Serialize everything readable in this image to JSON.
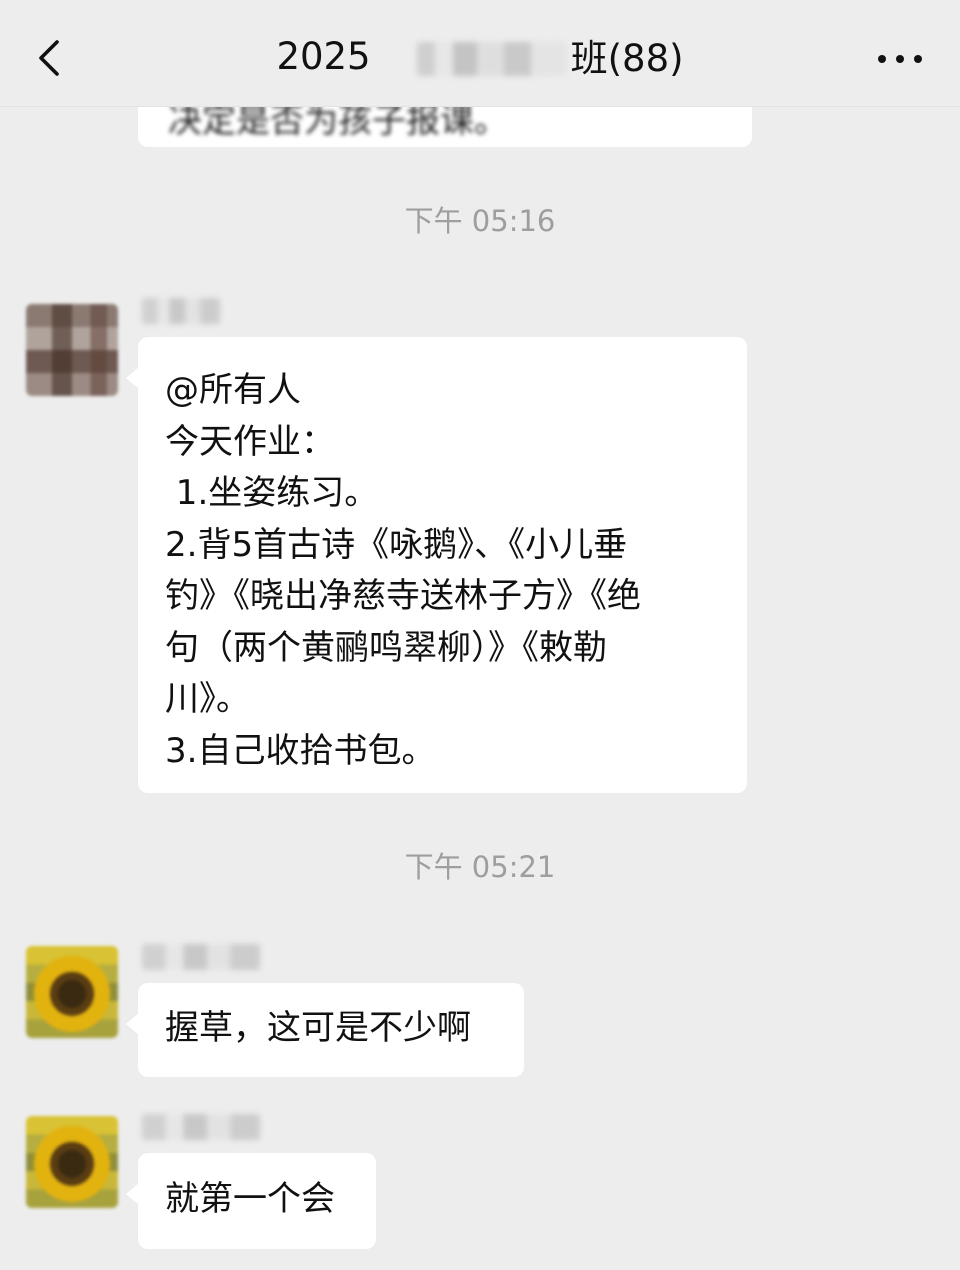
{
  "header": {
    "back_icon": "chevron-left-icon",
    "title_prefix": "2025",
    "title_suffix": "班(88)",
    "more_icon": "more-dots-icon"
  },
  "messages": {
    "prev_partial": "决定是否为孩子报课。",
    "time1": "下午 05:16",
    "homework": {
      "lines": [
        "@所有人",
        "今天作业：",
        " 1.坐姿练习。",
        "2.背5首古诗《咏鹅》、《小儿垂",
        "钓》《晓出净慈寺送林子方》《绝",
        "句（两个黄鹂鸣翠柳）》《敕勒",
        "川》。",
        "3.自己收拾书包。"
      ]
    },
    "time2": "下午 05:21",
    "reply1": "握草，这可是不少啊",
    "reply2": "就第一个会"
  }
}
